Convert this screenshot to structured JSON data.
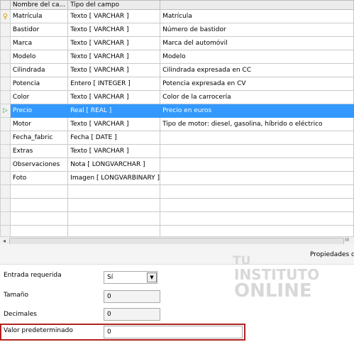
{
  "table": {
    "headers": [
      "",
      "Nombre del ca...",
      "Tipo del campo",
      ""
    ],
    "rows": [
      {
        "icon": "key",
        "name": "Matrícula",
        "type": "Texto [ VARCHAR ]",
        "desc": "Matrícula"
      },
      {
        "icon": "",
        "name": "Bastidor",
        "type": "Texto [ VARCHAR ]",
        "desc": "Número de bastidor"
      },
      {
        "icon": "",
        "name": "Marca",
        "type": "Texto [ VARCHAR ]",
        "desc": "Marca del automóvil"
      },
      {
        "icon": "",
        "name": "Modelo",
        "type": "Texto [ VARCHAR ]",
        "desc": "Modelo"
      },
      {
        "icon": "",
        "name": "Cilindrada",
        "type": "Texto [ VARCHAR ]",
        "desc": "Cilindrada expresada en CC"
      },
      {
        "icon": "",
        "name": "Potencia",
        "type": "Entero [ INTEGER ]",
        "desc": "Potencia expresada en CV"
      },
      {
        "icon": "",
        "name": "Color",
        "type": "Texto [ VARCHAR ]",
        "desc": "Color de la carrocería"
      },
      {
        "icon": "arrow",
        "name": "Precio",
        "type": "Real [ REAL ]",
        "desc": "Precio en euros",
        "active": true
      },
      {
        "icon": "",
        "name": "Motor",
        "type": "Texto [ VARCHAR ]",
        "desc": "Tipo de motor: diesel, gasolina, híbrido o eléctrico"
      },
      {
        "icon": "",
        "name": "Fecha_fabric",
        "type": "Fecha [ DATE ]",
        "desc": ""
      },
      {
        "icon": "",
        "name": "Extras",
        "type": "Texto [ VARCHAR ]",
        "desc": ""
      },
      {
        "icon": "",
        "name": "Observaciones",
        "type": "Nota [ LONGVARCHAR ]",
        "desc": ""
      },
      {
        "icon": "",
        "name": "Foto",
        "type": "Imagen [ LONGVARBINARY ]",
        "desc": ""
      }
    ],
    "empty_rows": 5
  },
  "scrollbar": {
    "left_arrow": "◂",
    "grip": "III"
  },
  "properties": {
    "title": "Propiedades de",
    "required_label": "Entrada requerida",
    "required_value": "Sí",
    "size_label": "Tamaño",
    "size_value": "0",
    "decimals_label": "Decimales",
    "decimals_value": "0",
    "default_label": "Valor predeterminado",
    "default_value": "0"
  },
  "watermark": {
    "line1": "TU",
    "line2": "INSTITUTO",
    "line3": "ONLINE"
  },
  "colors": {
    "selection": "#3399ff",
    "highlight_border": "#b22222",
    "key_icon": "#d9a300",
    "arrow_icon": "#2e9e2e"
  }
}
